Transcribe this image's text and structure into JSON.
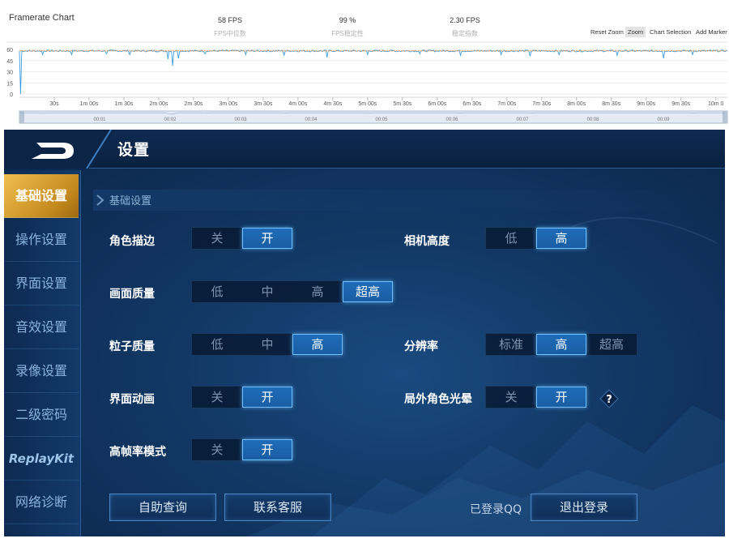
{
  "chart": {
    "title": "Framerate Chart",
    "stats": [
      {
        "value": "58 FPS",
        "label": "FPS中位数"
      },
      {
        "value": "99 %",
        "label": "FPS稳定性"
      },
      {
        "value": "2.30 FPS",
        "label": "稳定指数"
      }
    ],
    "toolbar": [
      "Reset Zoom",
      "Zoom",
      "Chart Selection",
      "Add Marker"
    ],
    "active_tool": "Zoom",
    "line_color": "#3d9de0",
    "median_color": "#e9893a"
  },
  "chart_data": {
    "type": "line",
    "title": "Framerate Chart",
    "y_ticks": [
      "60",
      "45",
      "30",
      "15",
      "0"
    ],
    "ylim": [
      0,
      60
    ],
    "x_ticks": [
      "30s",
      "1m 00s",
      "1m 30s",
      "2m 00s",
      "2m 30s",
      "3m 00s",
      "3m 30s",
      "4m 00s",
      "4m 30s",
      "5m 00s",
      "5m 30s",
      "6m 00s",
      "6m 30s",
      "7m 00s",
      "7m 30s",
      "8m 00s",
      "8m 30s",
      "9m 00s",
      "9m 30s",
      "10m 0"
    ],
    "x_seconds": [
      30,
      60,
      90,
      120,
      150,
      180,
      210,
      240,
      270,
      300,
      330,
      360,
      390,
      420,
      450,
      480,
      510,
      540,
      570,
      600
    ],
    "navigator_ticks": [
      "00:01",
      "00:02",
      "00:03",
      "00:04",
      "00:05",
      "00:06",
      "00:07",
      "00:08",
      "00:09"
    ],
    "baseline_fps": 58,
    "dips": [
      {
        "t": 1,
        "fps": 0
      },
      {
        "t": 20,
        "fps": 53
      },
      {
        "t": 45,
        "fps": 53
      },
      {
        "t": 75,
        "fps": 54
      },
      {
        "t": 95,
        "fps": 53
      },
      {
        "t": 128,
        "fps": 47
      },
      {
        "t": 132,
        "fps": 38
      },
      {
        "t": 137,
        "fps": 48
      },
      {
        "t": 160,
        "fps": 54
      },
      {
        "t": 195,
        "fps": 53
      },
      {
        "t": 228,
        "fps": 52
      },
      {
        "t": 265,
        "fps": 49
      },
      {
        "t": 300,
        "fps": 53
      },
      {
        "t": 345,
        "fps": 54
      },
      {
        "t": 380,
        "fps": 52
      },
      {
        "t": 415,
        "fps": 53
      },
      {
        "t": 440,
        "fps": 51
      },
      {
        "t": 465,
        "fps": 53
      },
      {
        "t": 515,
        "fps": 52
      },
      {
        "t": 555,
        "fps": 48
      },
      {
        "t": 580,
        "fps": 53
      }
    ],
    "median_fps": 58
  },
  "game": {
    "title": "设置",
    "sidebar": [
      {
        "label": "基础设置",
        "active": true
      },
      {
        "label": "操作设置"
      },
      {
        "label": "界面设置"
      },
      {
        "label": "音效设置"
      },
      {
        "label": "录像设置"
      },
      {
        "label": "二级密码"
      },
      {
        "label": "ReplayKit"
      },
      {
        "label": "网络诊断"
      }
    ],
    "section": "基础设置",
    "settings": {
      "outline": {
        "label": "角色描边",
        "options": [
          "关",
          "开"
        ],
        "selected": "开"
      },
      "camera": {
        "label": "相机高度",
        "options": [
          "低",
          "高"
        ],
        "selected": "高"
      },
      "quality": {
        "label": "画面质量",
        "options": [
          "低",
          "中",
          "高",
          "超高"
        ],
        "selected": "超高"
      },
      "particle": {
        "label": "粒子质量",
        "options": [
          "低",
          "中",
          "高"
        ],
        "selected": "高"
      },
      "resolution": {
        "label": "分辨率",
        "options": [
          "标准",
          "高",
          "超高"
        ],
        "selected": "高"
      },
      "ui_anim": {
        "label": "界面动画",
        "options": [
          "关",
          "开"
        ],
        "selected": "开"
      },
      "halo": {
        "label": "局外角色光晕",
        "options": [
          "关",
          "开"
        ],
        "selected": "开"
      },
      "hfr": {
        "label": "高帧率模式",
        "options": [
          "关",
          "开"
        ],
        "selected": "开"
      }
    },
    "help_glyph": "?",
    "buttons": {
      "self_help": "自助查询",
      "contact": "联系客服",
      "logout": "退出登录"
    },
    "login_status": "已登录QQ"
  }
}
